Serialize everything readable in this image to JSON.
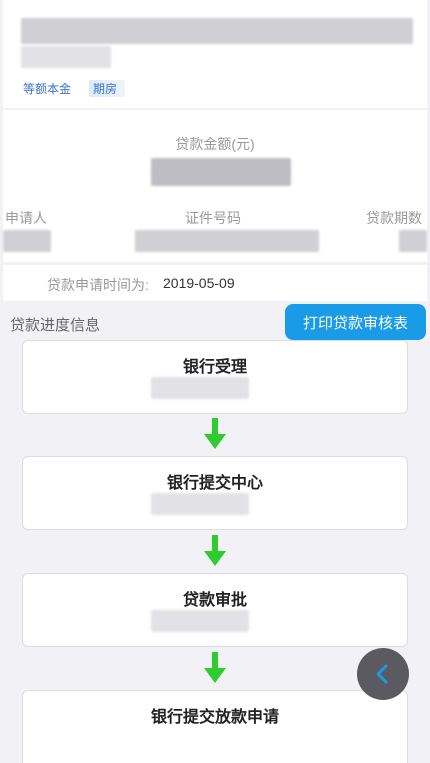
{
  "loan_card": {
    "repay_type": "等额本金",
    "term_tag": "期房"
  },
  "summary": {
    "amount_label": "贷款金额(元)",
    "applicant_label": "申请人",
    "id_label": "证件号码",
    "term_label": "贷款期数"
  },
  "apply": {
    "label": "贷款申请时间为:",
    "date": "2019-05-09"
  },
  "progress": {
    "title": "贷款进度信息",
    "print_button": "打印贷款审核表",
    "steps": [
      {
        "name": "银行受理"
      },
      {
        "name": "银行提交中心"
      },
      {
        "name": "贷款审批"
      },
      {
        "name": "银行提交放款申请"
      }
    ]
  },
  "colors": {
    "accent": "#1a9be8",
    "arrow": "#2ecc2e",
    "fab": "#5a5a60"
  },
  "icons": {
    "down_arrow": "down-arrow-icon",
    "back": "chevron-left-icon"
  }
}
